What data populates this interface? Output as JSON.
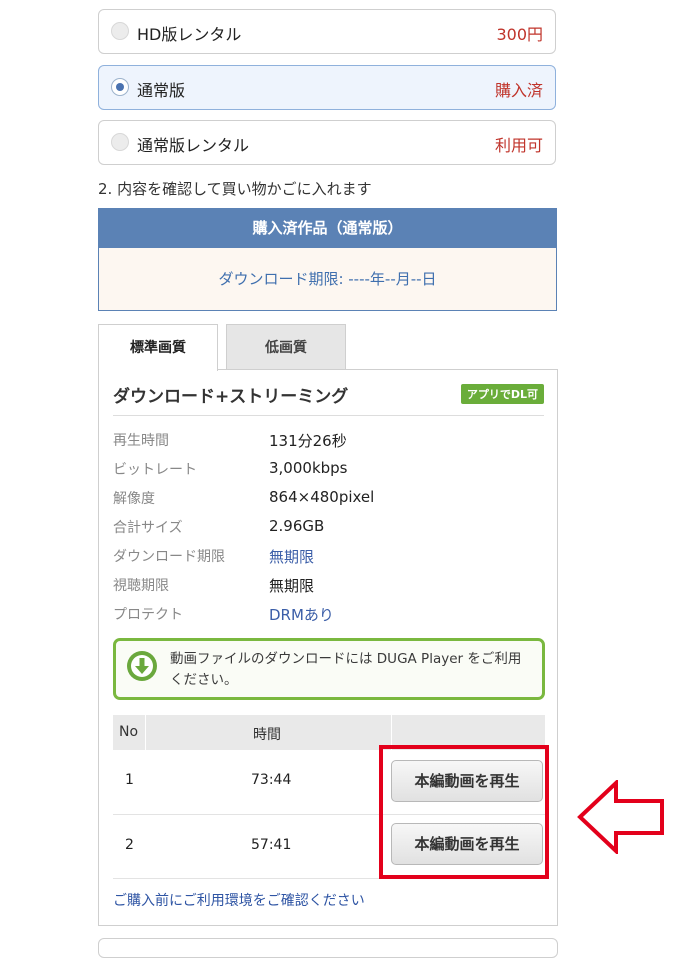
{
  "options": [
    {
      "label": "HD版レンタル",
      "price": "300円",
      "selected": false
    },
    {
      "label": "通常版",
      "price": "購入済",
      "selected": true
    },
    {
      "label": "通常版レンタル",
      "price": "利用可",
      "selected": false
    }
  ],
  "step_text": "2. 内容を確認して買い物かごに入れます",
  "purchased": {
    "header": "購入済作品（通常版）",
    "download_deadline": "ダウンロード期限: ----年--月--日"
  },
  "tabs": {
    "standard": "標準画質",
    "low": "低画質"
  },
  "panel": {
    "title": "ダウンロード+ストリーミング",
    "badge": "アプリでDL可",
    "specs": [
      {
        "key": "再生時間",
        "value": "131分26秒"
      },
      {
        "key": "ビットレート",
        "value": "3,000kbps"
      },
      {
        "key": "解像度",
        "value": "864×480pixel"
      },
      {
        "key": "合計サイズ",
        "value": "2.96GB"
      },
      {
        "key": "ダウンロード期限",
        "value": "無期限"
      },
      {
        "key": "視聴期限",
        "value": "無期限"
      },
      {
        "key": "プロテクト",
        "value": "DRMあり"
      }
    ],
    "notice": "動画ファイルのダウンロードには DUGA Player をご利用ください。",
    "table": {
      "col_no": "No",
      "col_time": "時間",
      "rows": [
        {
          "no": "1",
          "time": "73:44",
          "button": "本編動画を再生"
        },
        {
          "no": "2",
          "time": "57:41",
          "button": "本編動画を再生"
        }
      ]
    },
    "env_link": "ご購入前にご利用環境をご確認ください"
  },
  "colors": {
    "accent_blue": "#5b82b5",
    "price_red": "#c0342b",
    "badge_green": "#6aad3a",
    "highlight_red": "#e3001b"
  },
  "icons": {
    "notice": "download-circle-icon",
    "annotation": "left-arrow-icon"
  }
}
